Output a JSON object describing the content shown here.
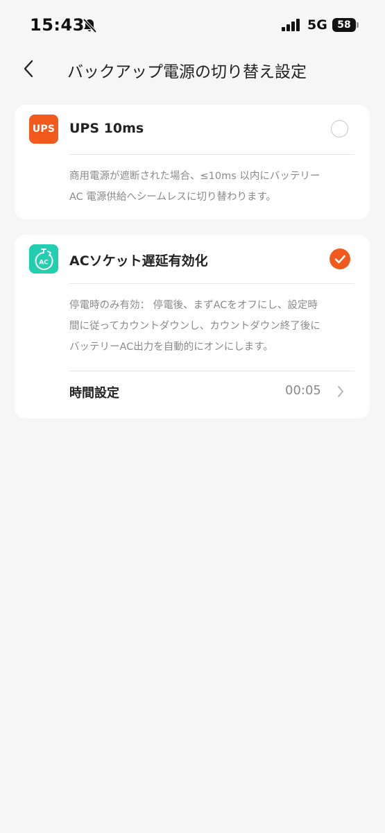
{
  "status_bar": {
    "time": "15:43",
    "network": "5G",
    "battery": "58"
  },
  "header": {
    "title": "バックアップ電源の切り替え設定"
  },
  "ups_option": {
    "icon_text": "UPS",
    "title": "UPS 10ms",
    "selected": false,
    "description_lines": [
      "商用電源が遮断された場合、≤10ms 以内にバッテリー",
      "AC 電源供給へシームレスに切り替わります。"
    ]
  },
  "ac_option": {
    "icon_text": "AC",
    "title": "ACソケット遅延有効化",
    "selected": true,
    "description_lines": [
      "停電時のみ有効： 停電後、まずACをオフにし、設定時",
      "間に従ってカウントダウンし、カウントダウン終了後に",
      "バッテリーAC出力を自動的にオンにします。"
    ],
    "time_setting": {
      "label": "時間設定",
      "value": "00:05"
    }
  },
  "colors": {
    "accent": "#f15a1c",
    "teal": "#21cfb0",
    "background": "#f6f6f6",
    "card": "#ffffff",
    "muted_text": "#8a8a8a"
  },
  "icons": {
    "back": "chevron-left-icon",
    "muted": "bell-slash-icon",
    "signal": "signal-bars-icon",
    "checkmark": "check-icon",
    "disclosure": "chevron-right-icon",
    "ac_timer": "stopwatch-icon"
  }
}
